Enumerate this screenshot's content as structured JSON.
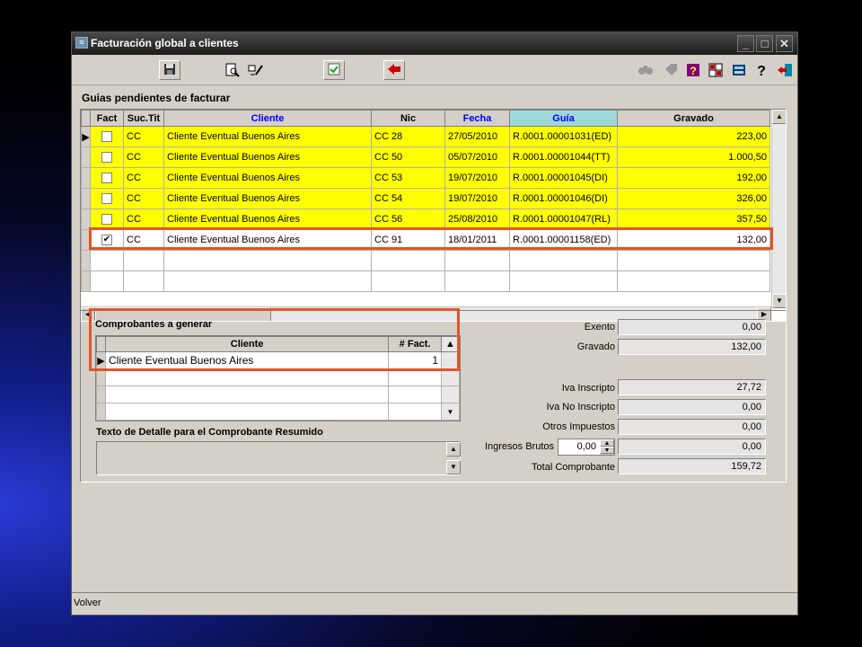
{
  "window": {
    "title": "Facturación global a clientes",
    "status": "Volver"
  },
  "sections": {
    "pending": "Guias pendientes de facturar",
    "to_generate": "Comprobantes a generar",
    "detail_text": "Texto de Detalle para el Comprobante Resumido"
  },
  "grid": {
    "columns": [
      "Fact",
      "Suc.Tit",
      "Cliente",
      "Nic",
      "Fecha",
      "Guía",
      "Gravado"
    ],
    "rows": [
      {
        "checked": false,
        "suc": "CC",
        "cliente": "Cliente Eventual Buenos Aires",
        "nic": "CC 28",
        "fecha": "27/05/2010",
        "guia": "R.0001.00001031(ED)",
        "gravado": "223,00"
      },
      {
        "checked": false,
        "suc": "CC",
        "cliente": "Cliente Eventual Buenos Aires",
        "nic": "CC 50",
        "fecha": "05/07/2010",
        "guia": "R.0001.00001044(TT)",
        "gravado": "1.000,50"
      },
      {
        "checked": false,
        "suc": "CC",
        "cliente": "Cliente Eventual Buenos Aires",
        "nic": "CC 53",
        "fecha": "19/07/2010",
        "guia": "R.0001.00001045(DI)",
        "gravado": "192,00"
      },
      {
        "checked": false,
        "suc": "CC",
        "cliente": "Cliente Eventual Buenos Aires",
        "nic": "CC 54",
        "fecha": "19/07/2010",
        "guia": "R.0001.00001046(DI)",
        "gravado": "326,00"
      },
      {
        "checked": false,
        "suc": "CC",
        "cliente": "Cliente Eventual Buenos Aires",
        "nic": "CC 56",
        "fecha": "25/08/2010",
        "guia": "R.0001.00001047(RL)",
        "gravado": "357,50"
      },
      {
        "checked": true,
        "suc": "CC",
        "cliente": "Cliente Eventual Buenos Aires",
        "nic": "CC 91",
        "fecha": "18/01/2011",
        "guia": "R.0001.00001158(ED)",
        "gravado": "132,00"
      }
    ]
  },
  "comprobantes": {
    "columns": [
      "Cliente",
      "# Fact."
    ],
    "rows": [
      {
        "cliente": "Cliente Eventual Buenos Aires",
        "fact": "1"
      }
    ]
  },
  "totals": {
    "exento_label": "Exento",
    "exento": "0,00",
    "gravado_label": "Gravado",
    "gravado": "132,00",
    "iva_insc_label": "Iva Inscripto",
    "iva_insc": "27,72",
    "iva_no_insc_label": "Iva No Inscripto",
    "iva_no_insc": "0,00",
    "otros_label": "Otros Impuestos",
    "otros": "0,00",
    "ingresos_label": "Ingresos Brutos",
    "ingresos_rate": "0,00",
    "ingresos": "0,00",
    "total_label": "Total Comprobante",
    "total": "159,72"
  },
  "colors": {
    "highlight": "#e0552a",
    "row_yellow": "#ffff00",
    "header_blue": "#0000ff",
    "guia_header_bg": "#9fd8d8"
  }
}
